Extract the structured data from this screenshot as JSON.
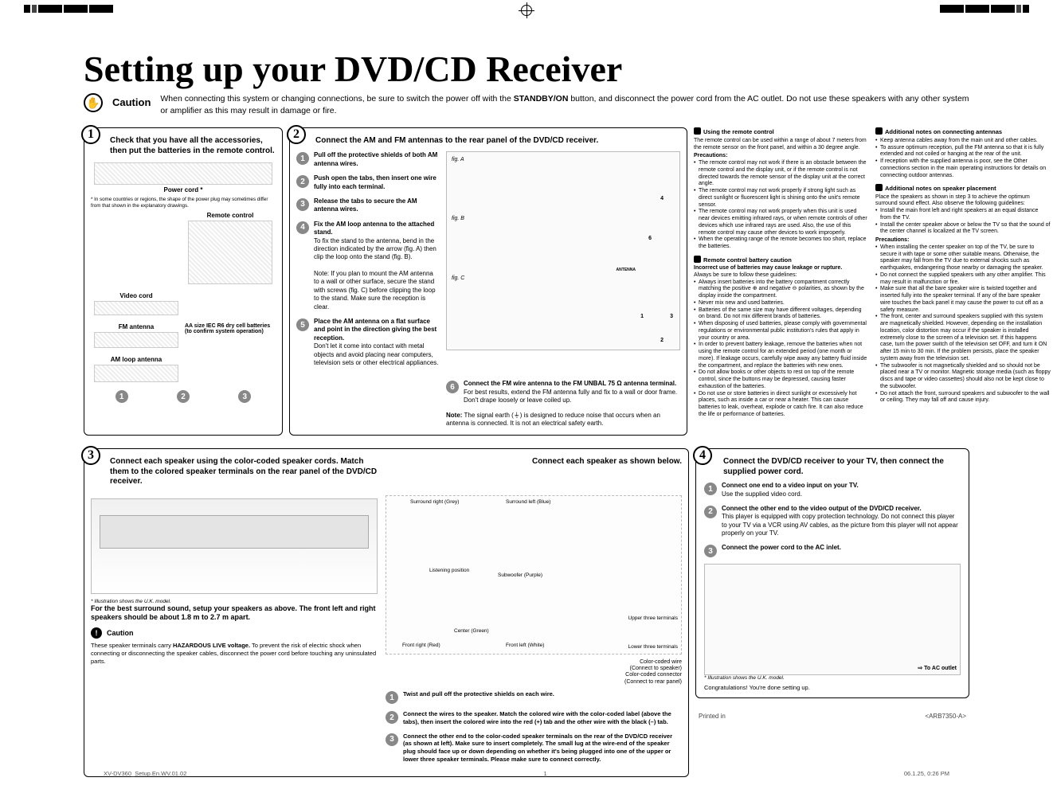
{
  "title": "Setting up your DVD/CD Receiver",
  "caution_label": "Caution",
  "caution_text_1": "When connecting this system or changing connections, be sure to switch the power off with the ",
  "caution_text_b": "STANDBY/ON",
  "caution_text_2": " button, and disconnect the power cord from the AC outlet. Do not use these speakers with any other system or amplifier as this may result in damage or fire.",
  "box1": {
    "num": "1",
    "head": "Check that you have all the accessories, then put the batteries in the remote control.",
    "power_cord": "Power cord *",
    "power_note": "* In some countries or regions, the shape of the power plug may sometimes differ from that shown in the explanatory drawings.",
    "remote": "Remote control",
    "video": "Video cord",
    "fm": "FM antenna",
    "batt": "AA size IEC R6 dry cell batteries (to confirm system operation)",
    "am": "AM loop antenna"
  },
  "box2": {
    "num": "2",
    "head": "Connect the AM and FM antennas to the rear panel of the DVD/CD receiver.",
    "s1": "Pull off the protective shields of both AM antenna wires.",
    "s2": "Push open the tabs, then insert one wire fully into each terminal.",
    "s3": "Release the tabs to secure the AM antenna wires.",
    "s4a": "Fix the AM loop antenna to the attached stand.",
    "s4b": "To fix the stand to the antenna, bend in the direction indicated by the arrow (fig. A) then clip the loop onto the stand (fig. B).",
    "s4note": "Note: If you plan to mount the AM antenna to a wall or other surface, secure the stand with screws (fig. C) before clipping the loop to the stand. Make sure the reception is clear.",
    "s5a": "Place the AM antenna on a flat surface and point in the direction giving the best reception.",
    "s5b": "Don't let it come into contact with metal objects and avoid placing near computers, television sets or other electrical appliances.",
    "s6a": "Connect the FM wire antenna to the FM UNBAL 75 Ω antenna terminal.",
    "s6b": "For best results, extend the FM antenna fully and fix to a wall or door frame. Don't drape loosely or leave coiled up.",
    "s6note_label": "Note:",
    "s6note": " The signal earth (⏚) is designed to reduce noise that occurs when an antenna is connected. It is not an electrical safety earth.",
    "figA": "fig. A",
    "figB": "fig. B",
    "figC": "fig. C",
    "antenna": "ANTENNA"
  },
  "col_remote": {
    "h": "Using the remote control",
    "p1": "The remote control can be used within a range of about 7 meters from the remote sensor on the front panel, and within a 30 degree angle.",
    "prec": "Precautions:",
    "b1": "The remote control may not work if there is an obstacle between the remote control and the display unit, or if the remote control is not directed towards the remote sensor of the display unit at the correct angle.",
    "b2": "The remote control may not work properly if strong light such as direct sunlight or fluorescent light is shining onto the unit's remote sensor.",
    "b3": "The remote control may not work properly when this unit is used near devices emitting infrared rays, or when remote controls of other devices which use infrared rays are used. Also, the use of this remote control may cause other devices to work improperly.",
    "b4": "When the operating range of the remote becomes too short, replace the batteries.",
    "batt_h": "Remote control battery caution",
    "batt_warn": "Incorrect use of batteries may cause leakage or rupture.",
    "batt_intro": "Always be sure to follow these guidelines:",
    "bb1": "Always insert batteries into the battery compartment correctly matching the positive ⊕ and negative ⊖ polarities, as shown by the display inside the compartment.",
    "bb2": "Never mix new and used batteries.",
    "bb3": "Batteries of the same size may have different voltages, depending on brand. Do not mix different brands of batteries.",
    "bb4": "When disposing of used batteries, please comply with governmental regulations or environmental public institution's rules that apply in your country or area.",
    "bb5": "In order to prevent battery leakage, remove the batteries when not using the remote control for an extended period (one month or more). If leakage occurs, carefully wipe away any battery fluid inside the compartment, and replace the batteries with new ones.",
    "bb6": "Do not allow books or other objects to rest on top of the remote control, since the buttons may be depressed, causing faster exhaustion of the batteries.",
    "bb7": "Do not use or store batteries in direct sunlight or excessively hot places, such as inside a car or near a heater. This can cause batteries to leak, overheat, explode or catch fire. It can also reduce the life or performance of batteries."
  },
  "col_ant": {
    "h1": "Additional notes on connecting antennas",
    "a1": "Keep antenna cables away from the main unit and other cables.",
    "a2": "To assure optimum reception, pull the FM antenna so that it is fully extended and not coiled or hanging at the rear of the unit.",
    "a3": "If reception with the supplied antenna is poor, see the Other connections section in the main operating instructions for details on connecting outdoor antennas.",
    "h2": "Additional notes on speaker placement",
    "p2": "Place the speakers as shown in step 3 to achieve the optimum surround sound effect. Also observe the following guidelines:",
    "s1": "Install the main front left and right speakers at an equal distance from the TV.",
    "s2": "Install the center speaker above or below the TV so that the sound of the center channel is localized at the TV screen.",
    "prec": "Precautions:",
    "pp1": "When installing the center speaker on top of the TV, be sure to secure it with tape or some other suitable means. Otherwise, the speaker may fall from the TV due to external shocks such as earthquakes, endangering those nearby or damaging the speaker.",
    "pp2": "Do not connect the supplied speakers with any other amplifier. This may result in malfunction or fire.",
    "pp3": "Make sure that all the bare speaker wire is twisted together and inserted fully into the speaker terminal. If any of the bare speaker wire touches the back panel it may cause the power to cut off as a safety measure.",
    "pp4": "The front, center and surround speakers supplied with this system are magnetically shielded. However, depending on the installation location, color distortion may occur if the speaker is installed extremely close to the screen of a television set. If this happens case, turn the power switch of the television set OFF, and turn it ON after 15 min to 30 min. If the problem persists, place the speaker system away from the television set.",
    "pp5": "The subwoofer is not magnetically shielded and so should not be placed near a TV or monitor. Magnetic storage media (such as floppy discs and tape or video cassettes) should also not be kept close to the subwoofer.",
    "pp6": "Do not attach the front, surround speakers and subwoofer to the wall or ceiling. They may fall off and cause injury."
  },
  "box3": {
    "num": "3",
    "head": "Connect each speaker using the color-coded speaker cords. Match them to the colored speaker terminals on the rear panel of the DVD/CD receiver.",
    "head_r": "Connect each speaker as shown below.",
    "illus_note": "* Illustration shows the U.K. model.",
    "adv": "For the best surround sound, setup your speakers as above. The front left and right speakers should be about 1.8 m to 2.7 m apart.",
    "caution": "Caution",
    "caution_body_1": "These speaker terminals carry ",
    "caution_body_b": "HAZARDOUS LIVE voltage.",
    "caution_body_2": " To prevent the risk of electric shock when connecting or disconnecting the speaker cables, disconnect the power cord before touching any uninsulated parts.",
    "labels": {
      "sr": "Surround right\n(Grey)",
      "sl": "Surround left\n(Blue)",
      "fr": "Front right\n(Red)",
      "fl": "Front left\n(White)",
      "c": "Center (Green)",
      "sub": "Subwoofer (Purple)",
      "lp": "Listening position",
      "upper": "Upper three terminals",
      "lower": "Lower three terminals"
    },
    "cc1": "Color-coded wire\n(Connect to speaker)",
    "cc2": "Color-coded connector\n(Connect to rear panel)",
    "r1a": "Twist and pull off the protective shields on each wire.",
    "r2a": "Connect the wires to the speaker. Match the colored wire with the color-coded label (above the tabs), then insert the colored wire into the red (+) tab and the other wire with the black (–) tab.",
    "r3a": "Connect the other end to the color-coded speaker terminals on the rear of the DVD/CD receiver (as shown at left). Make sure to insert completely. The small lug at the wire-end of the speaker plug should face up or down depending on whether it's being plugged into one of the upper or lower three speaker terminals. Please make sure to connect correctly."
  },
  "box4": {
    "num": "4",
    "head": "Connect the DVD/CD receiver to your TV, then connect the supplied power cord.",
    "s1a": "Connect one end to a video input on your TV.",
    "s1b": "Use the supplied video cord.",
    "s2a": "Connect the other end to the video output of the DVD/CD receiver.",
    "s2b": "This player is equipped with copy protection technology. Do not connect this player to your TV via a VCR using AV cables, as the picture from this player will not appear properly on your TV.",
    "s3a": "Connect the power cord to the AC inlet.",
    "illus_note": "* Illustration shows the U.K. model.",
    "ac": "To AC outlet",
    "congrats": "Congratulations! You're done setting up."
  },
  "footer": {
    "printed": "Printed in",
    "code": "<ARB7350-A>",
    "fn": "XV-DV360_Setup.En.WV.01.02",
    "page": "1",
    "ts": "06.1.25, 0:26 PM"
  }
}
